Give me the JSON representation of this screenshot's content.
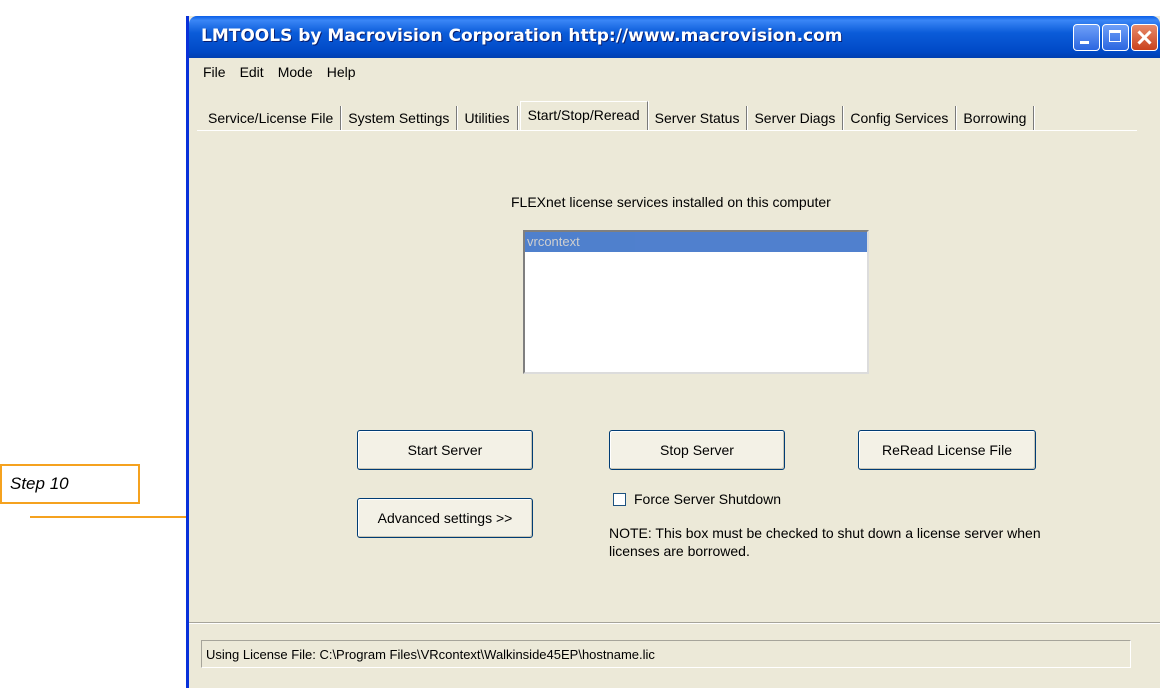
{
  "window": {
    "title": "LMTOOLS by Macrovision Corporation http://www.macrovision.com"
  },
  "menu": [
    "File",
    "Edit",
    "Mode",
    "Help"
  ],
  "tabs": [
    {
      "label": "Service/License File",
      "active": false
    },
    {
      "label": "System Settings",
      "active": false
    },
    {
      "label": "Utilities",
      "active": false
    },
    {
      "label": "Start/Stop/Reread",
      "active": true
    },
    {
      "label": "Server Status",
      "active": false
    },
    {
      "label": "Server Diags",
      "active": false
    },
    {
      "label": "Config Services",
      "active": false
    },
    {
      "label": "Borrowing",
      "active": false
    }
  ],
  "services": {
    "label": "FLEXnet license services installed on this computer",
    "items": [
      "vrcontext"
    ]
  },
  "buttons": {
    "start": "Start Server",
    "stop": "Stop Server",
    "reread": "ReRead License File",
    "advanced": "Advanced settings >>"
  },
  "force_shutdown": {
    "label": "Force Server Shutdown",
    "checked": false
  },
  "note": "NOTE:  This box must be checked to shut down a license server when licenses are borrowed.",
  "status": "Using License File:  C:\\Program Files\\VRcontext\\Walkinside45EP\\hostname.lic",
  "callout": {
    "label": "Step 10",
    "color": "#f5a21f"
  }
}
